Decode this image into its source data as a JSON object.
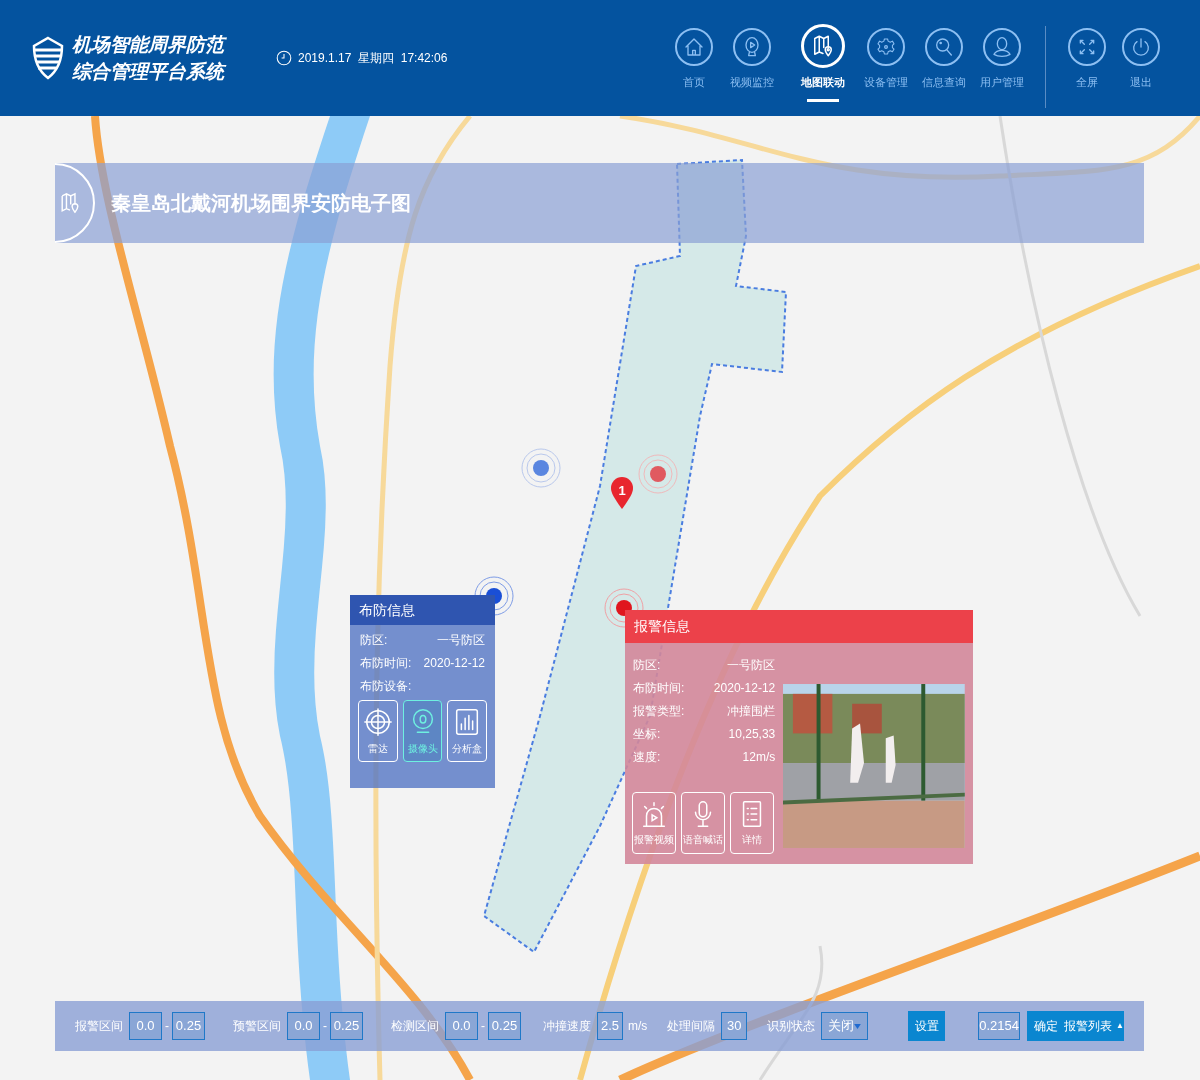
{
  "header": {
    "title_lines": [
      "机场智能周界防范",
      "综合管理平台系统"
    ],
    "datetime": "2019.1.17  星期四  17:42:06",
    "nav": [
      {
        "label": "首页",
        "selected": false
      },
      {
        "label": "视频监控",
        "selected": false
      },
      {
        "label": "地图联动",
        "selected": true
      },
      {
        "label": "设备管理",
        "selected": false
      },
      {
        "label": "信息查询",
        "selected": false
      },
      {
        "label": "用户管理",
        "selected": false
      }
    ],
    "actions": [
      {
        "label": "全屏"
      },
      {
        "label": "退出"
      }
    ]
  },
  "map": {
    "title": "秦皇岛北戴河机场围界安防电子图",
    "marker_count": "1"
  },
  "defense_panel": {
    "title": "布防信息",
    "fields": [
      {
        "label": "防区:",
        "value": "一号防区"
      },
      {
        "label": "布防时间:",
        "value": "2020-12-12"
      },
      {
        "label": "布防设备:"
      }
    ],
    "devices": [
      {
        "label": "雷达",
        "selected": false
      },
      {
        "label": "摄像头",
        "selected": true
      },
      {
        "label": "分析盒",
        "selected": false
      }
    ]
  },
  "alarm_panel": {
    "title": "报警信息",
    "fields": [
      {
        "label": "防区:",
        "value": "一号防区"
      },
      {
        "label": "布防时间:",
        "value": "2020-12-12"
      },
      {
        "label": "报警类型:",
        "value": "冲撞围栏"
      },
      {
        "label": "坐标:",
        "value": "10,25,33"
      },
      {
        "label": "速度:",
        "value": "12m/s"
      }
    ],
    "actions": [
      {
        "label": "报警视频"
      },
      {
        "label": "语音喊话"
      },
      {
        "label": "详情"
      }
    ]
  },
  "toolbar": {
    "ranges": [
      {
        "label": "报警区间",
        "from": "0.0",
        "separator": "-",
        "to": "0.25"
      },
      {
        "label": "预警区间",
        "from": "0.0",
        "separator": "-",
        "to": "0.25"
      },
      {
        "label": "检测区间",
        "from": "0.0",
        "separator": "-",
        "to": "0.25"
      }
    ],
    "speed": {
      "label": "冲撞速度",
      "value": "2.5",
      "unit": "m/s"
    },
    "interval": {
      "label": "处理间隔",
      "value": "30"
    },
    "status": {
      "label": "识别状态",
      "value": "关闭"
    },
    "set_button": "设置",
    "threshold": "0.2154",
    "confirm_button": "确定",
    "alarm_list_button": "报警列表",
    "alarm_list_arrow": "▲"
  }
}
